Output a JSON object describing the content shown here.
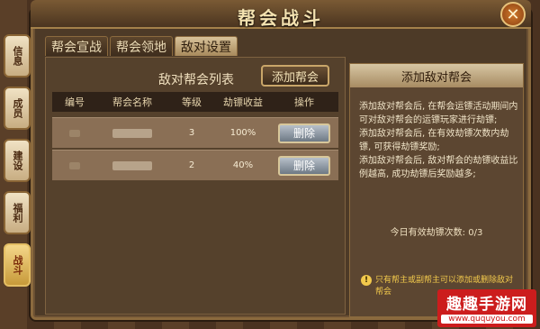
{
  "window": {
    "title": "帮会战斗"
  },
  "side_tabs": [
    {
      "label": "信息"
    },
    {
      "label": "成员"
    },
    {
      "label": "建设"
    },
    {
      "label": "福利"
    },
    {
      "label": "战斗"
    }
  ],
  "tabs": [
    {
      "label": "帮会宣战"
    },
    {
      "label": "帮会领地"
    },
    {
      "label": "敌对设置"
    }
  ],
  "enemy_list": {
    "title": "敌对帮会列表",
    "add_button": "添加帮会",
    "columns": [
      "编号",
      "帮会名称",
      "等级",
      "劫镖收益",
      "操作"
    ],
    "rows": [
      {
        "level": "3",
        "income": "100%",
        "action": "删除"
      },
      {
        "level": "2",
        "income": "40%",
        "action": "删除"
      }
    ]
  },
  "add_panel": {
    "title": "添加敌对帮会",
    "desc": [
      "添加敌对帮会后, 在帮会运镖活动期间内可对敌对帮会的运镖玩家进行劫镖;",
      "添加敌对帮会后, 在有效劫镖次数内劫镖, 可获得劫镖奖励;",
      "添加敌对帮会后, 敌对帮会的劫镖收益比例越高, 成功劫镖后奖励越多;"
    ],
    "count_text": "今日有效劫镖次数: 0/3",
    "warning": "只有帮主或副帮主可以添加或删除敌对帮会"
  },
  "watermark": {
    "main": "趣趣手游网",
    "sub": "www.ququyou.com"
  }
}
